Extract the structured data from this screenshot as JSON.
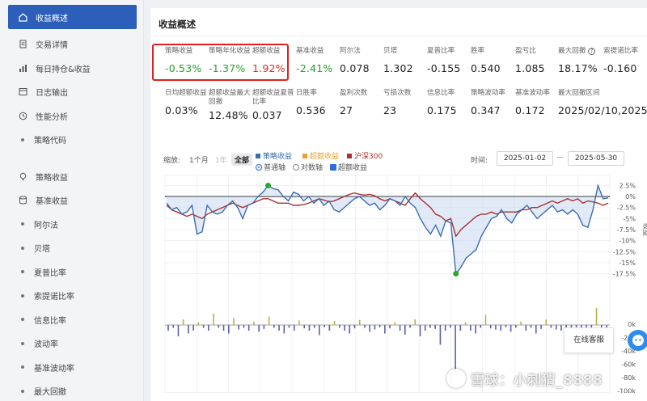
{
  "sidebar": {
    "items": [
      {
        "label": "收益概述",
        "icon": "home-icon",
        "active": true
      },
      {
        "label": "交易详情",
        "icon": "document-icon"
      },
      {
        "label": "每日持仓&收益",
        "icon": "bar-chart-icon"
      },
      {
        "label": "日志输出",
        "icon": "log-icon"
      },
      {
        "label": "性能分析",
        "icon": "clock-icon"
      },
      {
        "label": "策略代码",
        "icon": "dot",
        "sub": true
      }
    ],
    "items2": [
      {
        "label": "策略收益",
        "icon": "bulb-icon"
      },
      {
        "label": "基准收益",
        "icon": "database-icon"
      },
      {
        "label": "阿尔法",
        "sub": true
      },
      {
        "label": "贝塔",
        "sub": true
      },
      {
        "label": "夏普比率",
        "sub": true
      },
      {
        "label": "索提诺比率",
        "sub": true
      },
      {
        "label": "信息比率",
        "sub": true
      },
      {
        "label": "波动率",
        "sub": true
      },
      {
        "label": "基准波动率",
        "sub": true
      },
      {
        "label": "最大回撤",
        "sub": true
      }
    ]
  },
  "main": {
    "title": "收益概述",
    "metrics_row1": [
      {
        "label": "策略收益",
        "value": "-0.53%",
        "color": "green"
      },
      {
        "label": "策略年化收益",
        "value": "-1.37%",
        "color": "green"
      },
      {
        "label": "超额收益",
        "value": "1.92%",
        "color": "red"
      },
      {
        "label": "基准收益",
        "value": "-2.41%",
        "color": "green"
      },
      {
        "label": "阿尔法",
        "value": "0.078"
      },
      {
        "label": "贝塔",
        "value": "1.302"
      },
      {
        "label": "夏普比率",
        "value": "-0.155"
      },
      {
        "label": "胜率",
        "value": "0.540"
      },
      {
        "label": "盈亏比",
        "value": "1.085"
      },
      {
        "label": "最大回撤",
        "value": "18.17%",
        "help": true
      },
      {
        "label": "索提诺比率",
        "value": "-0.160"
      }
    ],
    "metrics_row2": [
      {
        "label": "日均超额收益",
        "value": "0.03%"
      },
      {
        "label": "超额收益最大回撤",
        "value": "12.48%"
      },
      {
        "label": "超额收益夏普比率",
        "value": "0.037"
      },
      {
        "label": "日胜率",
        "value": "0.536"
      },
      {
        "label": "盈利次数",
        "value": "27"
      },
      {
        "label": "亏损次数",
        "value": "23"
      },
      {
        "label": "信息比率",
        "value": "0.175"
      },
      {
        "label": "策略波动率",
        "value": "0.347"
      },
      {
        "label": "基准波动率",
        "value": "0.172"
      },
      {
        "label": "最大回撤区间",
        "value": "2025/02/10,2025/"
      }
    ]
  },
  "controls": {
    "zoom_label": "缩放:",
    "zoom_options": [
      "1个月",
      "1年",
      "全部"
    ],
    "legend": [
      {
        "name": "策略收益",
        "color": "#3b6db3"
      },
      {
        "name": "超额收益",
        "color": "#f0a030"
      },
      {
        "name": "沪深300",
        "color": "#a83232"
      }
    ],
    "axis_normal": "普通轴",
    "axis_log": "对数轴",
    "excess_check": "超额收益",
    "time_label": "时间:",
    "date_from": "2025-01-02",
    "date_to": "2025-05-30"
  },
  "chart_data": {
    "type": "line",
    "y_ticks": [
      "2.5%",
      "0%",
      "-2.5%",
      "-5%",
      "-7.5%",
      "-10%",
      "-12.5%",
      "-15%",
      "-17.5%"
    ],
    "y_axis_label": "收益",
    "ylim": [
      -18.5,
      3.5
    ],
    "lower_ticks": [
      "0k",
      "-20k",
      "-40k",
      "-60k",
      "-80k",
      "-100k"
    ],
    "series": [
      {
        "name": "策略收益",
        "color": "#3b6db3",
        "values": [
          -1.5,
          -3,
          -2.5,
          -4,
          -3.5,
          -2,
          -8.5,
          -8,
          -2,
          -3.5,
          -4,
          -3.5,
          -2,
          -1,
          -2.5,
          -5,
          -2,
          -1.5,
          0,
          1,
          2.5,
          1.8,
          1.5,
          0,
          -1,
          1,
          0.5,
          -1,
          0,
          -1.5,
          -0.5,
          -2,
          -1,
          -3,
          -3.5,
          -2.5,
          -1.5,
          -0.5,
          0,
          -1,
          -2,
          -1.5,
          -3,
          -2,
          -0.5,
          -1,
          -2,
          0,
          -1.5,
          -2.5,
          -5,
          -7,
          -8.5,
          -6.5,
          -9,
          -5.5,
          -6,
          -17.5,
          -16,
          -14,
          -13,
          -12,
          -9,
          -7,
          -5,
          -4.5,
          -3,
          -5,
          -6,
          -4,
          -3,
          -2,
          -3.5,
          -5,
          -4,
          -3,
          -2,
          -3.5,
          -3,
          -4,
          -3,
          -4,
          -6.5,
          -7,
          -3,
          2.5,
          -0.5,
          -0.3
        ]
      },
      {
        "name": "沪深300",
        "color": "#a83232",
        "values": [
          -2,
          -3,
          -3.5,
          -4,
          -4.5,
          -4,
          -4.5,
          -5,
          -4,
          -3.5,
          -3,
          -2.5,
          -2,
          -1.5,
          -2,
          -2.5,
          -2,
          -1.5,
          -1,
          -0.5,
          -0.5,
          -1,
          -1.5,
          -1.5,
          -1.5,
          -2,
          -2,
          -1.8,
          -1.5,
          -1,
          -0.5,
          -0.8,
          -1.2,
          -1,
          -0.5,
          0,
          0.5,
          0.8,
          0.5,
          0.3,
          0.5,
          0.2,
          -0.5,
          -1,
          -0.5,
          -1,
          -1.5,
          -2,
          -0.5,
          0.8,
          -0.5,
          -1.5,
          -2.5,
          -4,
          -4.5,
          -5.5,
          -5,
          -9,
          -7.5,
          -6.5,
          -5.5,
          -4.5,
          -4,
          -4,
          -3.5,
          -4,
          -3.5,
          -3.5,
          -3.5,
          -3.5,
          -3,
          -3,
          -2.5,
          -2.5,
          -2,
          -1.5,
          -1,
          -1.5,
          -1,
          -0.5,
          -1,
          -0.5,
          -1.5,
          -1,
          -1.2,
          -1.5,
          -2,
          -1.5
        ]
      }
    ],
    "markers": [
      {
        "label": "high",
        "color": "#2aa82a"
      },
      {
        "label": "low",
        "color": "#2aa82a"
      }
    ],
    "bars": [
      -1,
      -0.5,
      -2,
      1,
      -1.5,
      -1,
      0.5,
      -0.5,
      -1,
      2,
      -0.5,
      -1,
      -1.5,
      1.2,
      -0.8,
      -0.5,
      -1,
      0.6,
      -1.2,
      -0.7,
      1.5,
      -0.5,
      -1,
      -1.5,
      -0.5,
      -1,
      0.8,
      -0.6,
      -1,
      -0.5,
      -1.8,
      -0.4,
      -1,
      0.7,
      -0.5,
      -1,
      -1.5,
      -0.6,
      0.9,
      -0.5,
      -1.2,
      -0.8,
      -0.4,
      -1.5,
      -0.6,
      0.5,
      -1,
      -1.7,
      -0.5,
      1,
      -2,
      -1,
      -0.5,
      -0.7,
      -3.5,
      -1,
      -0.5,
      -8,
      -1,
      0.5,
      -1,
      -1.5,
      -0.5,
      1.8,
      -0.6,
      -0.8,
      -1,
      -0.4,
      -1.2,
      -0.5,
      0.6,
      -1,
      -0.5,
      -1.5,
      -0.7,
      1,
      -0.5,
      -0.8,
      -1,
      -0.6,
      -1.2,
      -0.4,
      -0.5,
      -1.4,
      -0.6,
      3,
      -0.5,
      -1
    ]
  },
  "service": {
    "label": "在线客服"
  },
  "watermark": {
    "text": "雪球：小刺猬_8888"
  }
}
